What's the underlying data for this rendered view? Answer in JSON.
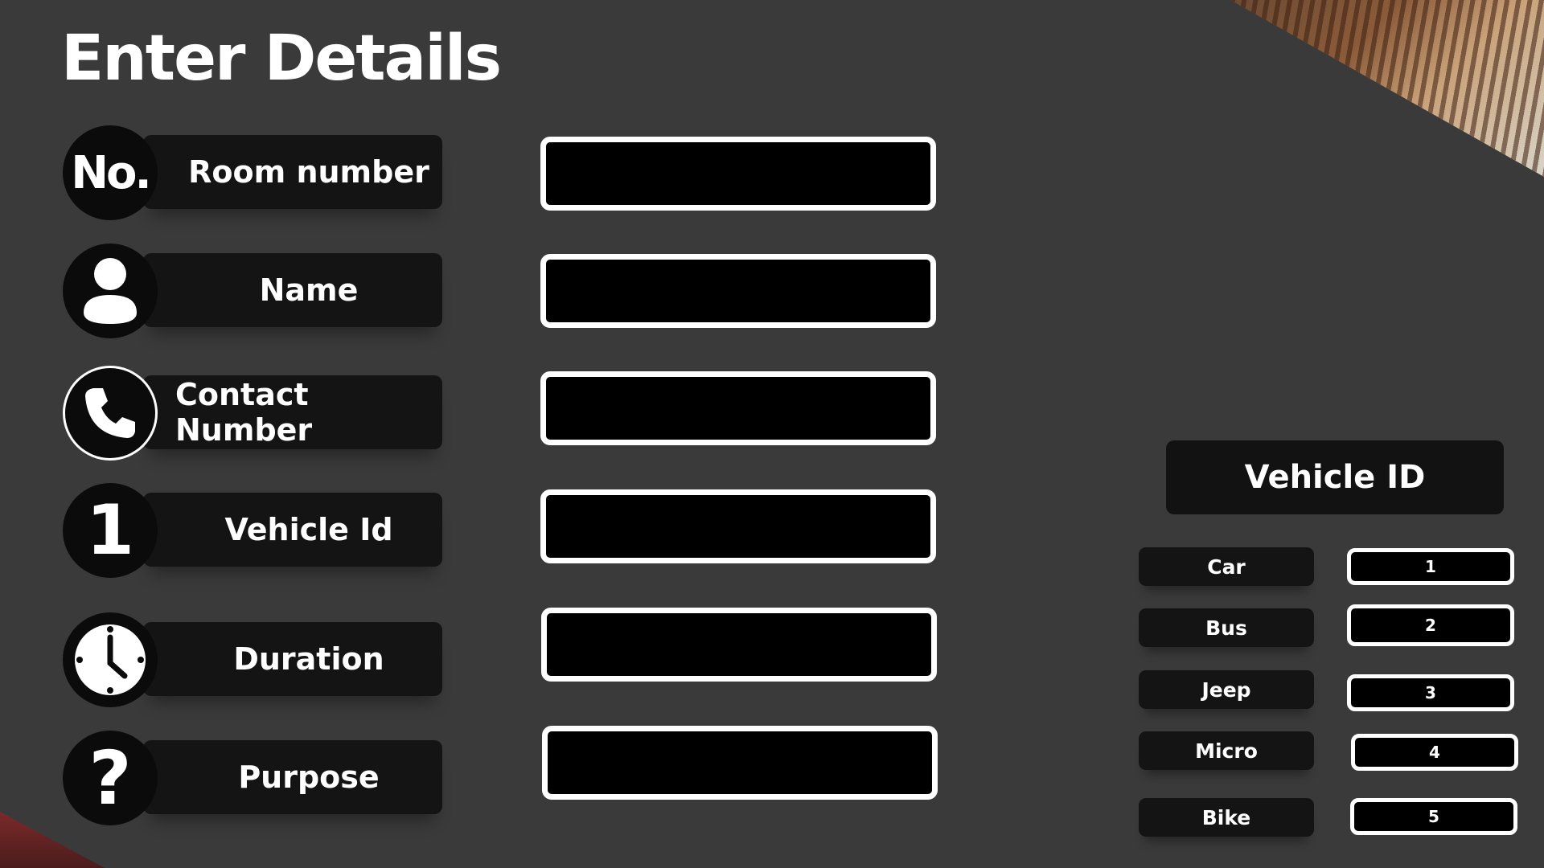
{
  "title": "Enter Details",
  "fields": [
    {
      "label": "Room number",
      "icon": "number-icon",
      "icon_text": "No."
    },
    {
      "label": "Name",
      "icon": "person-icon"
    },
    {
      "label": "Contact Number",
      "icon": "phone-icon"
    },
    {
      "label": "Vehicle Id",
      "icon": "digit-one-icon",
      "icon_text": "1"
    },
    {
      "label": "Duration",
      "icon": "clock-icon"
    },
    {
      "label": "Purpose",
      "icon": "question-icon",
      "icon_text": "?"
    }
  ],
  "vehicle_panel": {
    "title": "Vehicle ID",
    "types": [
      {
        "label": "Car",
        "value": "1"
      },
      {
        "label": "Bus",
        "value": "2"
      },
      {
        "label": "Jeep",
        "value": "3"
      },
      {
        "label": "Micro",
        "value": "4"
      },
      {
        "label": "Bike",
        "value": "5"
      }
    ]
  },
  "colors": {
    "background": "#3a3a3a",
    "pill": "#141414",
    "input_border": "#ffffff",
    "input_fill": "#000000"
  }
}
